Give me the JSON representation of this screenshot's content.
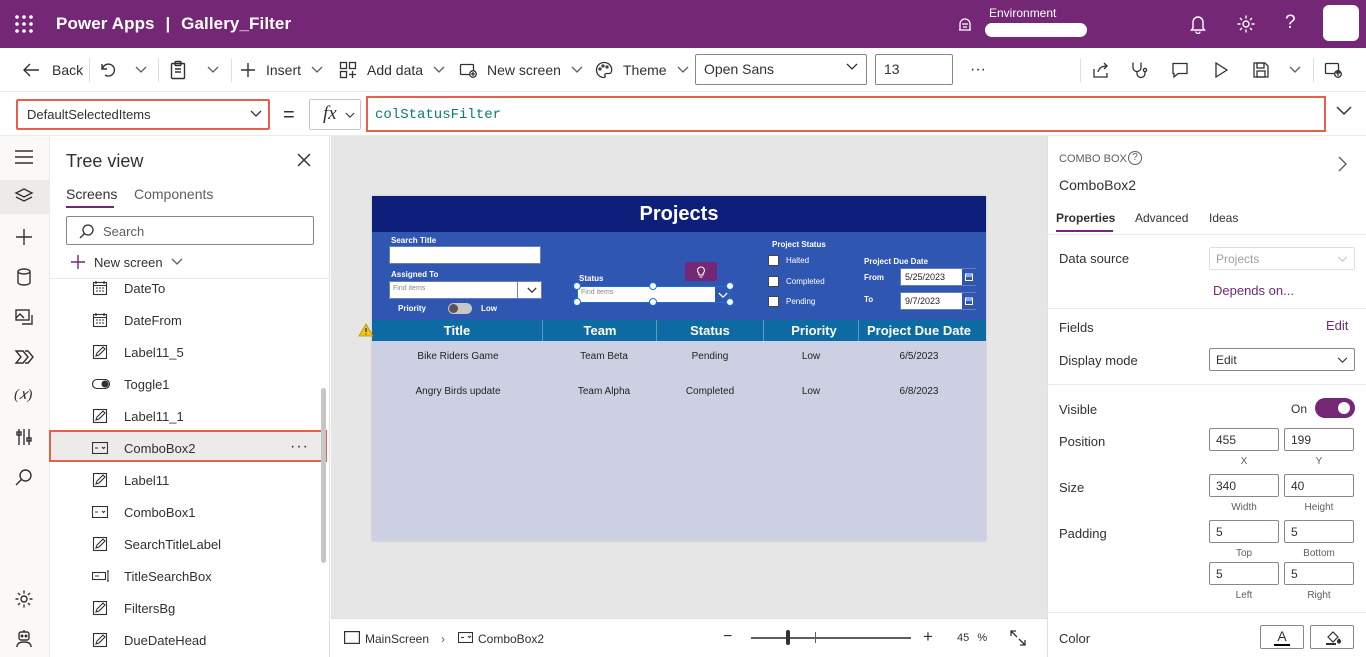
{
  "topbar": {
    "app_name": "Power Apps",
    "separator": "|",
    "file_name": "Gallery_Filter",
    "environment_label": "Environment",
    "bg_color": "#742774"
  },
  "commandbar": {
    "back": "Back",
    "insert": "Insert",
    "add_data": "Add data",
    "new_screen": "New screen",
    "theme": "Theme",
    "font": "Open Sans",
    "font_size": "13",
    "more": "···"
  },
  "formulabar": {
    "property": "DefaultSelectedItems",
    "equals": "=",
    "fx": "fx",
    "formula": "colStatusFilter"
  },
  "tree": {
    "title": "Tree view",
    "tabs": [
      "Screens",
      "Components"
    ],
    "search_placeholder": "Search",
    "new_screen": "New screen",
    "items": [
      {
        "label": "DateTo",
        "icon": "calendar-icon"
      },
      {
        "label": "DateFrom",
        "icon": "calendar-icon"
      },
      {
        "label": "Label11_5",
        "icon": "label-edit-icon"
      },
      {
        "label": "Toggle1",
        "icon": "toggle-icon"
      },
      {
        "label": "Label11_1",
        "icon": "label-edit-icon"
      },
      {
        "label": "ComboBox2",
        "icon": "combobox-icon",
        "selected": true
      },
      {
        "label": "Label11",
        "icon": "label-edit-icon"
      },
      {
        "label": "ComboBox1",
        "icon": "combobox-icon"
      },
      {
        "label": "SearchTitleLabel",
        "icon": "label-edit-icon"
      },
      {
        "label": "TitleSearchBox",
        "icon": "textinput-icon"
      },
      {
        "label": "FiltersBg",
        "icon": "label-edit-icon"
      },
      {
        "label": "DueDateHead",
        "icon": "label-edit-icon"
      }
    ]
  },
  "app": {
    "title": "Projects",
    "search_title_label": "Search Title",
    "assigned_to_label": "Assigned To",
    "assigned_placeholder": "Find items",
    "priority_label": "Priority",
    "priority_value": "Low",
    "status_label": "Status",
    "status_placeholder": "Find items",
    "project_status_label": "Project Status",
    "status_options": [
      "Halted",
      "Completed",
      "Pending"
    ],
    "due_date_label": "Project Due Date",
    "from_label": "From",
    "from_value": "5/25/2023",
    "to_label": "To",
    "to_value": "9/7/2023",
    "columns": [
      "Title",
      "Team",
      "Status",
      "Priority",
      "Project Due Date"
    ],
    "rows": [
      [
        "Bike Riders Game",
        "Team Beta",
        "Pending",
        "Low",
        "6/5/2023"
      ],
      [
        "Angry Birds update",
        "Team Alpha",
        "Completed",
        "Low",
        "6/8/2023"
      ]
    ]
  },
  "statusbar": {
    "screen": "MainScreen",
    "control": "ComboBox2",
    "zoom": "45",
    "zoom_unit": "%"
  },
  "props": {
    "type": "COMBO BOX",
    "name": "ComboBox2",
    "tabs": [
      "Properties",
      "Advanced",
      "Ideas"
    ],
    "data_source_label": "Data source",
    "data_source_value": "Projects",
    "depends_on": "Depends on...",
    "fields_label": "Fields",
    "fields_edit": "Edit",
    "display_mode_label": "Display mode",
    "display_mode_value": "Edit",
    "visible_label": "Visible",
    "visible_value": "On",
    "position_label": "Position",
    "x": "455",
    "y": "199",
    "x_label": "X",
    "y_label": "Y",
    "size_label": "Size",
    "width": "340",
    "height": "40",
    "width_label": "Width",
    "height_label": "Height",
    "padding_label": "Padding",
    "pad_top": "5",
    "pad_bottom": "5",
    "pad_left": "5",
    "pad_right": "5",
    "top_label": "Top",
    "bottom_label": "Bottom",
    "left_label": "Left",
    "right_label": "Right",
    "color_label": "Color",
    "color_a": "A"
  }
}
